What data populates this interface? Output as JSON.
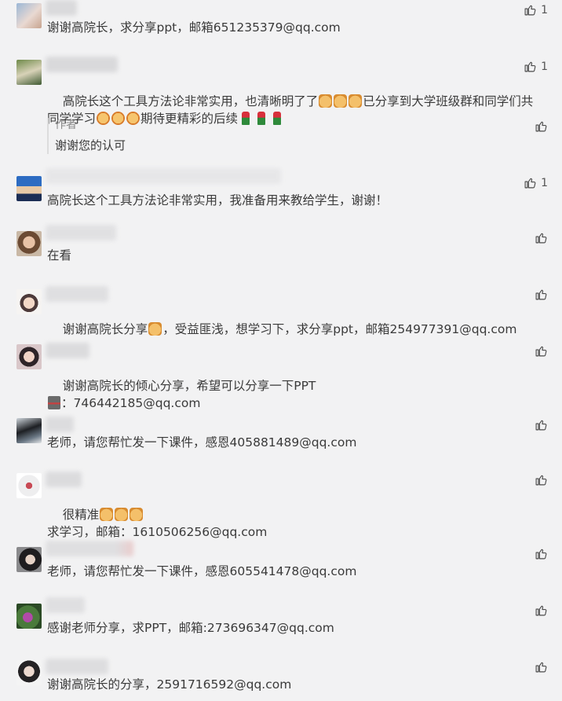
{
  "comments": [
    {
      "text": "谢谢高院长，求分享ppt，邮箱651235379@qq.com",
      "likes": "1"
    },
    {
      "text_a": "高院长这个工具方法论非常实用，也清晰明了了",
      "text_b": "已分享到大学班级群和同学们共",
      "text_c": "同学学习",
      "text_d": "期待更精彩的后续",
      "likes": "1",
      "reply": {
        "author": "作者",
        "text": "谢谢您的认可"
      }
    },
    {
      "text": "高院长这个工具方法论非常实用，我准备用来教给学生，谢谢！",
      "likes": "1"
    },
    {
      "text": "在看"
    },
    {
      "text_a": "谢谢高院长分享",
      "text_b": "，受益匪浅，想学习下，求分享ppt，邮箱254977391@qq.com"
    },
    {
      "text_a": "谢谢高院长的倾心分享，希望可以分享一下PPT",
      "text_b": "：746442185@qq.com"
    },
    {
      "text": "老师，请您帮忙发一下课件，感恩405881489@qq.com"
    },
    {
      "text_a": "很精准",
      "text_b": "求学习，邮箱：1610506256@qq.com"
    },
    {
      "text": "老师，请您帮忙发一下课件，感恩605541478@qq.com"
    },
    {
      "text": "感谢老师分享，求PPT，邮箱:273696347@qq.com"
    },
    {
      "text": "谢谢高院长的分享，2591716592@qq.com"
    }
  ],
  "icons": {
    "like": "thumbs-up-icon"
  }
}
